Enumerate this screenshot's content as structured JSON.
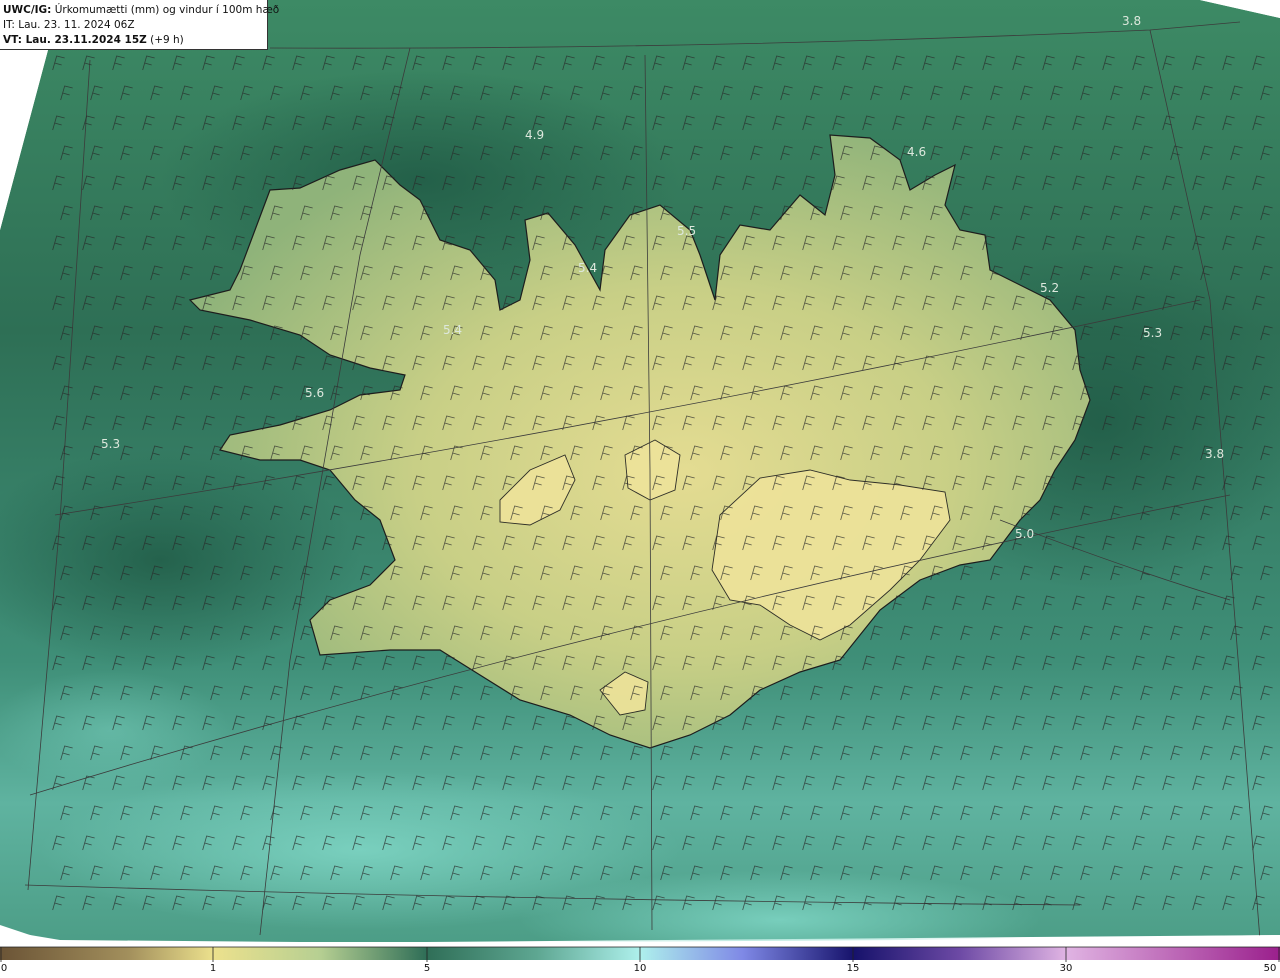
{
  "header": {
    "line1_bold": "UWC/IG:",
    "line1_text": " Úrkomumætti (mm) og vindur í 100m hæð",
    "line2_text": "IT: Lau. 23. 11. 2024 06Z",
    "line3_bold": "VT: Lau. 23.11.2024 15Z",
    "line3_text": " (+9 h)"
  },
  "map_values": [
    "3.8",
    "4.9",
    "4.6",
    "5.5",
    "5.4",
    "5.4",
    "5.2",
    "5.3",
    "5.6",
    "5.3",
    "3.8",
    "5.0"
  ],
  "colorbar": {
    "ticks": [
      "0",
      "1",
      "5",
      "10",
      "15",
      "30",
      "50"
    ],
    "colors": [
      "#6b5436",
      "#b9a86a",
      "#ece18d",
      "#e8e49a",
      "#2f6e57",
      "#5ea792",
      "#aef0ec",
      "#3a3dd0",
      "#16126b",
      "#d49ad6",
      "#9a1f8c"
    ]
  }
}
